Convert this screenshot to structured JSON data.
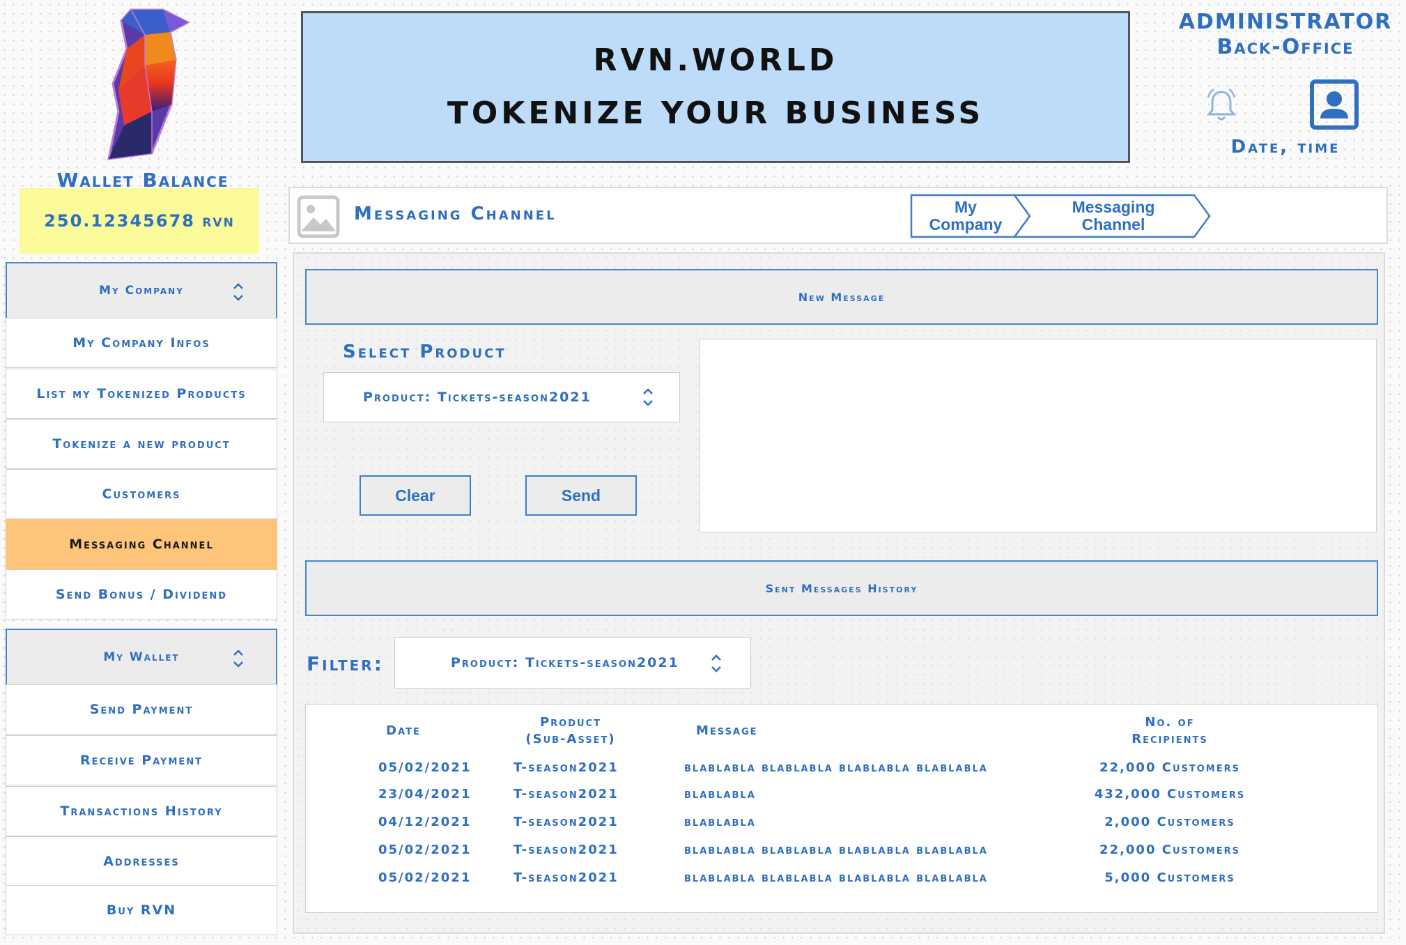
{
  "wallet": {
    "title": "Wallet Balance",
    "balance": "250.12345678 rvn"
  },
  "sidebar": {
    "company_header": "My Company",
    "company_items": [
      {
        "label": "My Company Infos"
      },
      {
        "label": "List my Tokenized Products"
      },
      {
        "label": "Tokenize a new product"
      },
      {
        "label": "Customers"
      },
      {
        "label": "Messaging Channel",
        "active": true
      },
      {
        "label": "Send Bonus / Dividend"
      }
    ],
    "wallet_header": "My Wallet",
    "wallet_items": [
      {
        "label": "Send Payment"
      },
      {
        "label": "Receive Payment"
      },
      {
        "label": "Transactions History"
      },
      {
        "label": "Addresses"
      },
      {
        "label": "Buy RVN"
      }
    ]
  },
  "banner": {
    "line1": "RVN.WORLD",
    "line2": "TOKENIZE YOUR BUSINESS"
  },
  "admin": {
    "line1": "ADMINISTRATOR",
    "line2": "Back-Office",
    "datetime": "Date, time"
  },
  "page": {
    "title": "Messaging Channel",
    "breadcrumb": [
      {
        "line1": "My",
        "line2": "Company"
      },
      {
        "line1": "Messaging",
        "line2": "Channel"
      }
    ]
  },
  "new_message": {
    "band_label": "New Message",
    "select_label": "Select Product",
    "product_value": "Product: Tickets-season2021",
    "message_text": "",
    "clear_label": "Clear",
    "send_label": "Send"
  },
  "history": {
    "band_label": "Sent Messages History",
    "filter_label": "Filter:",
    "filter_value": "Product: Tickets-season2021",
    "columns": {
      "date": "Date",
      "product_1": "Product",
      "product_2": "(Sub-Asset)",
      "message": "Message",
      "recipients_1": "No. of",
      "recipients_2": "Recipients"
    },
    "rows": [
      {
        "date": "05/02/2021",
        "product": "T-season2021",
        "message": "blablabla blablabla blablabla blablabla",
        "recipients": "22,000 Customers"
      },
      {
        "date": "23/04/2021",
        "product": "T-season2021",
        "message": "blablabla",
        "recipients": "432,000 Customers"
      },
      {
        "date": "04/12/2021",
        "product": "T-season2021",
        "message": "blablabla",
        "recipients": "2,000 Customers"
      },
      {
        "date": "05/02/2021",
        "product": "T-season2021",
        "message": "blablabla blablabla blablabla blablabla",
        "recipients": "22,000 Customers"
      },
      {
        "date": "05/02/2021",
        "product": "T-season2021",
        "message": "blablabla blablabla blablabla blablabla",
        "recipients": "5,000 Customers"
      }
    ]
  },
  "colors": {
    "accent": "#2f6fbf",
    "banner": "#bcdcfa",
    "balance_bg": "#fbfb99",
    "active_item": "#fdc47a"
  },
  "icons": [
    "raven-logo",
    "bell-icon",
    "user-profile-icon",
    "image-placeholder-icon",
    "chevron-updown-icon"
  ]
}
